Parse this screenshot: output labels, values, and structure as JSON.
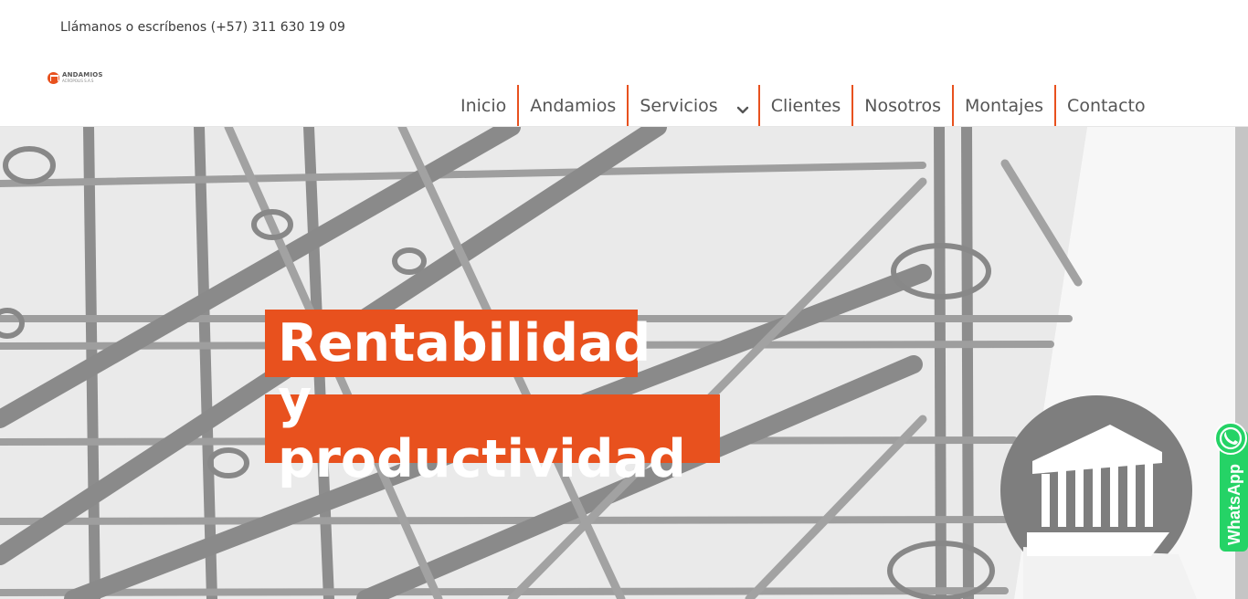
{
  "topbar": {
    "phone_text": "Llámanos o escríbenos (+57) 311 630 19 09"
  },
  "logo": {
    "line1": "ANDAMIOS",
    "line2": "ACRÓPOLIS S.A.S",
    "mark_icon": "building-icon",
    "brand_color": "#e8511e"
  },
  "nav": {
    "items": [
      {
        "label": "Inicio"
      },
      {
        "label": "Andamios"
      },
      {
        "label": "Servicios",
        "icon": "chevron-down-icon"
      },
      {
        "label": "Clientes"
      },
      {
        "label": "Nosotros"
      },
      {
        "label": "Montajes"
      },
      {
        "label": "Contacto"
      }
    ],
    "accent_color": "#e8511e"
  },
  "hero": {
    "headline_line1": "Rentabilidad",
    "headline_line2": "y productividad",
    "badge_icon": "temple-building-icon"
  },
  "whatsapp": {
    "label": "WhatsApp",
    "icon": "whatsapp-icon",
    "color": "#25d366"
  }
}
